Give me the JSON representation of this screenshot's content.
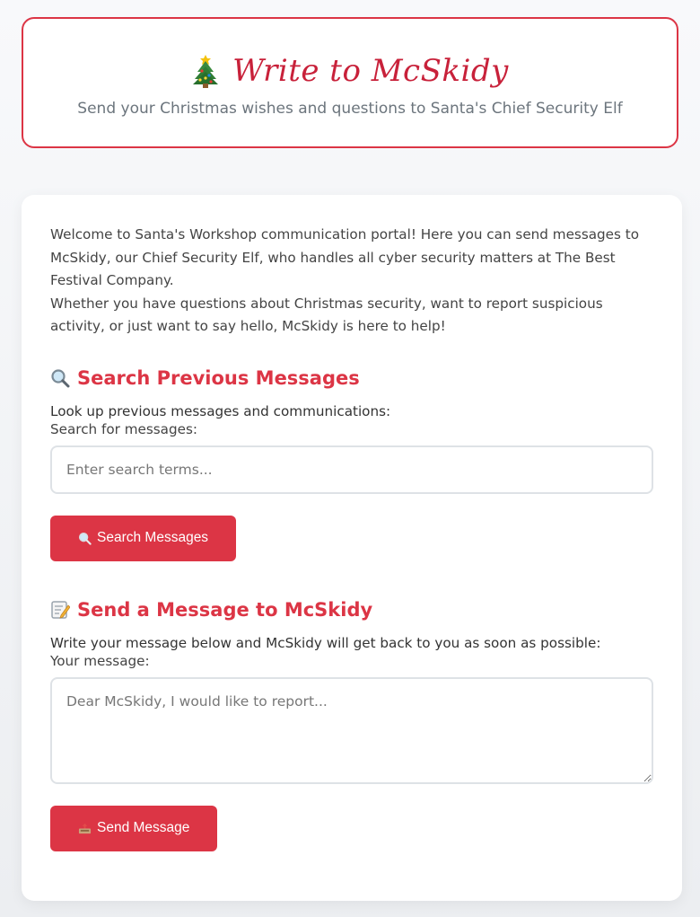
{
  "header": {
    "icon": "christmas-tree-icon",
    "title": "Write to McSkidy",
    "subtitle": "Send your Christmas wishes and questions to Santa's Chief Security Elf"
  },
  "intro": {
    "paragraph1": "Welcome to Santa's Workshop communication portal! Here you can send messages to McSkidy, our Chief Security Elf, who handles all cyber security matters at The Best Festival Company.",
    "paragraph2": "Whether you have questions about Christmas security, want to report suspicious activity, or just want to say hello, McSkidy is here to help!"
  },
  "search": {
    "icon": "magnifying-glass-icon",
    "title": "Search Previous Messages",
    "description": "Look up previous messages and communications:",
    "label": "Search for messages:",
    "placeholder": "Enter search terms...",
    "value": "",
    "button_icon": "magnifying-glass-icon",
    "button_label": "Search Messages"
  },
  "send": {
    "icon": "memo-icon",
    "title": "Send a Message to McSkidy",
    "description": "Write your message below and McSkidy will get back to you as soon as possible:",
    "label": "Your message:",
    "placeholder": "Dear McSkidy, I would like to report...",
    "value": "",
    "button_icon": "inbox-tray-icon",
    "button_label": "Send Message"
  },
  "colors": {
    "accent": "#dc3545",
    "title": "#c8213a",
    "muted": "#6c757d",
    "border": "#dee2e6"
  }
}
